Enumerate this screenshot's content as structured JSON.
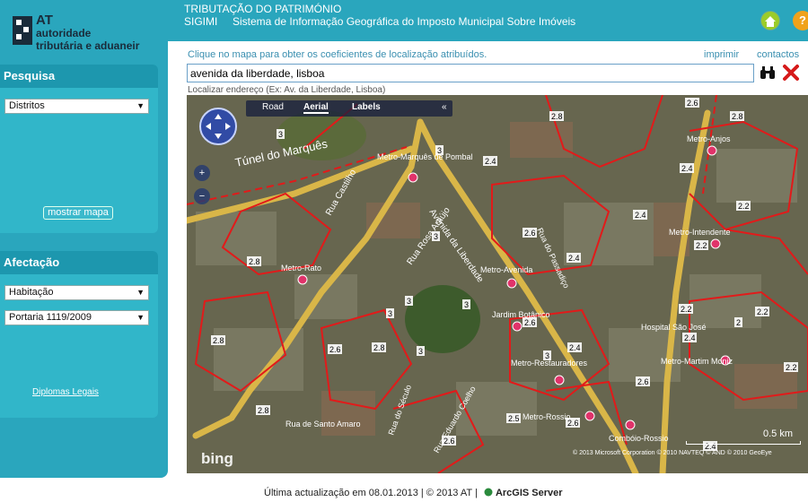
{
  "brand": {
    "acronym": "AT",
    "line1": "autoridade",
    "line2": "tributária e aduaneir"
  },
  "header": {
    "title": "TRIBUTAÇÃO DO PATRIMÓNIO",
    "system_code": "SIGIMI",
    "system_name": "Sistema de Informação Geográfica do Imposto Municipal Sobre Imóveis",
    "help_label": "?"
  },
  "pesquisa": {
    "heading": "Pesquisa",
    "select_value": "Distritos",
    "button_label": "mostrar mapa"
  },
  "afectacao": {
    "heading": "Afectação",
    "use_value": "Habitação",
    "portaria_value": "Portaria 1119/2009",
    "link_label": "Diplomas Legais"
  },
  "toolbar": {
    "hint": "Clique no mapa para obter os coeficientes de localização atribuídos.",
    "print_label": "imprimir",
    "contacts_label": "contactos",
    "search_value": "avenida da liberdade, lisboa",
    "address_hint": "Localizar endereço (Ex: Av. da Liberdade, Lisboa)"
  },
  "map": {
    "tabs": [
      "Road",
      "Aerial",
      "Labels"
    ],
    "active_tab": "Aerial",
    "collapse_label": "«",
    "zoom_in": "+",
    "zoom_out": "−",
    "bing": "bing",
    "copyright": "© 2013 Microsoft Corporation   © 2010 NAVTEQ   © AND   © 2010 GeoEye",
    "scale": "0.5 km",
    "streets": [
      "Túnel do Marquês",
      "Rua Castilho",
      "Rua Rosa Araújo",
      "Avenida da Liberdade",
      "Rua do Passadiço",
      "Rua de Santo Amaro",
      "Rua do Século",
      "Rua Eduardo Coelho"
    ],
    "places": [
      "Metro-Marquês de Pombal",
      "Metro-Anjos",
      "Metro-Intendente",
      "Metro-Avenida",
      "Metro-Rato",
      "Jardim Botânico",
      "Metro-Restauradores",
      "Hospital São José",
      "Metro-Martim Moniz",
      "Metro-Rossio",
      "Combóio-Rossio"
    ],
    "coefficients": [
      "2.6",
      "2.8",
      "3",
      "2.8",
      "3",
      "2.4",
      "2.4",
      "2.2",
      "2.4",
      "2.6",
      "2.4",
      "2.2",
      "2.8",
      "3",
      "3",
      "2.6",
      "2.2",
      "2.2",
      "2.8",
      "2.6",
      "2.8",
      "3",
      "2.4",
      "2.4",
      "2.6",
      "2.2",
      "2.8",
      "2.6",
      "2.5",
      "2.6",
      "2.4",
      "2",
      "3",
      "3",
      "3"
    ],
    "colors": {
      "boundary": "#e21a1a",
      "main_road": "#d9b648"
    }
  },
  "footer": {
    "text": "Última actualização em 08.01.2013 | © 2013 AT |",
    "server": "ArcGIS Server"
  }
}
